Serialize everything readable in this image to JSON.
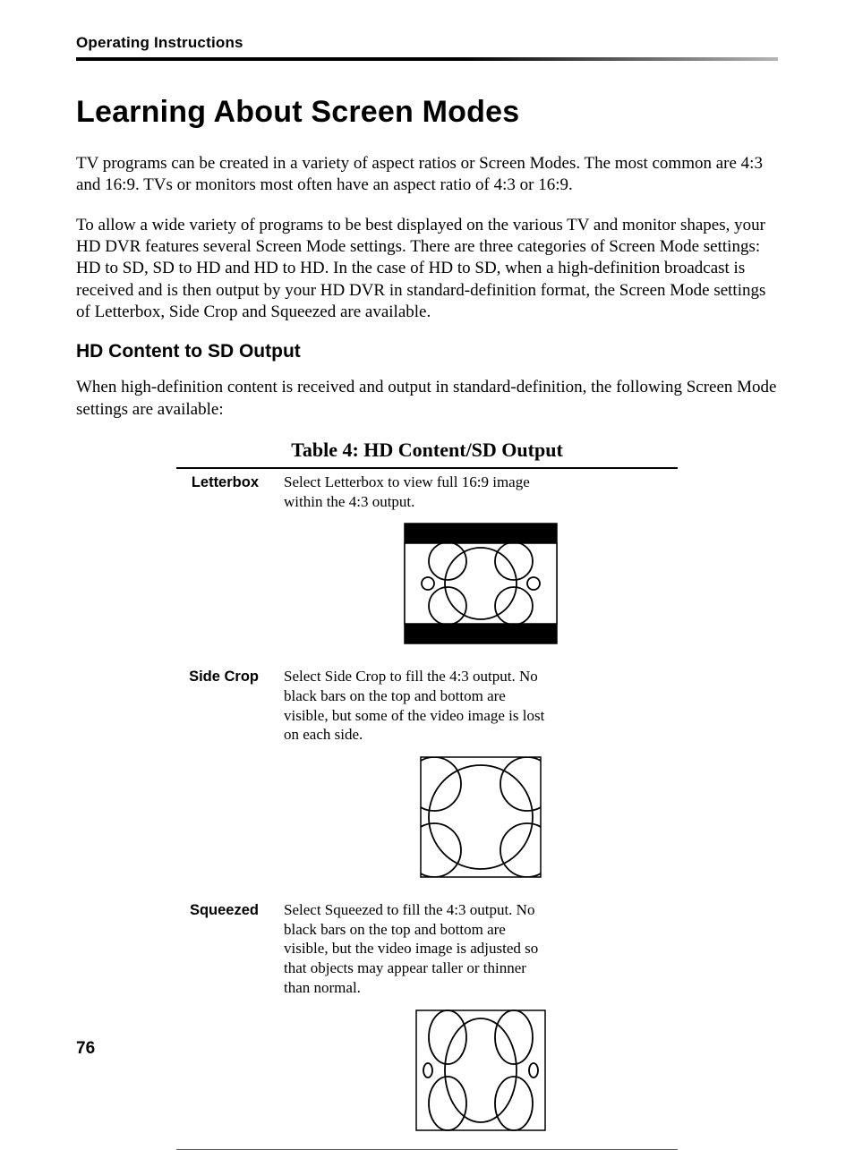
{
  "header": {
    "running_head": "Operating Instructions"
  },
  "title": "Learning About Screen Modes",
  "intro_p1": "TV programs can be created in a variety of aspect ratios or Screen Modes. The most common are 4:3 and 16:9. TVs or monitors most often have an aspect ratio of 4:3 or 16:9.",
  "intro_p2": "To allow a wide variety of programs to be best displayed on the various TV and monitor shapes, your HD DVR features several Screen Mode settings. There are three categories of Screen Mode settings: HD to SD, SD to HD and HD to HD. In the case of HD to SD, when a high-definition broadcast is received and is then output by your HD DVR in standard-definition format, the Screen Mode settings of Letterbox, Side Crop and Squeezed are available.",
  "section_title": "HD Content to SD Output",
  "section_p": "When high-definition content is received and output in standard-definition, the following Screen Mode settings are available:",
  "table": {
    "caption": "Table 4: HD Content/SD Output",
    "rows": [
      {
        "label": "Letterbox",
        "desc": "Select Letterbox to view full 16:9 image within the 4:3 output."
      },
      {
        "label": "Side Crop",
        "desc": "Select Side Crop to fill the 4:3 output. No black bars on the top and bottom are visible, but some of the video image is lost on each side."
      },
      {
        "label": "Squeezed",
        "desc": "Select Squeezed to fill the 4:3 output. No black bars on the top and bottom are visible, but the video image is adjusted so that objects may appear taller or thinner than normal."
      }
    ]
  },
  "page_number": "76"
}
